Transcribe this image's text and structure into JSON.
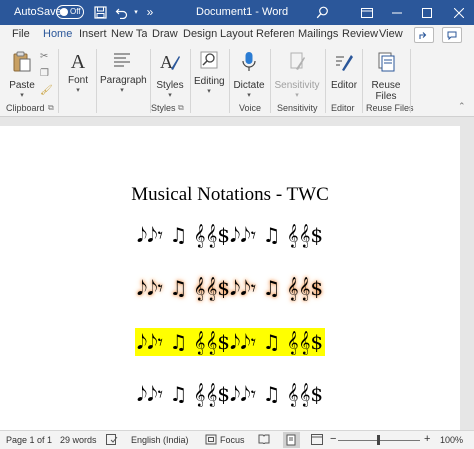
{
  "titlebar": {
    "autosave_label": "AutoSave",
    "autosave_state": "Off",
    "document_title": "Document1  -  Word",
    "more_glyph": "»"
  },
  "tabs": [
    {
      "label": "File"
    },
    {
      "label": "Home"
    },
    {
      "label": "Insert"
    },
    {
      "label": "New Tab"
    },
    {
      "label": "Draw"
    },
    {
      "label": "Design"
    },
    {
      "label": "Layout"
    },
    {
      "label": "References"
    },
    {
      "label": "Mailings"
    },
    {
      "label": "Review"
    },
    {
      "label": "View"
    }
  ],
  "ribbon": {
    "paste": "Paste",
    "font": "Font",
    "paragraph": "Paragraph",
    "styles": "Styles",
    "editing": "Editing",
    "dictate": "Dictate",
    "sensitivity": "Sensitivity",
    "editor": "Editor",
    "reuse_files_line1": "Reuse",
    "reuse_files_line2": "Files",
    "groups": {
      "clipboard": "Clipboard",
      "styles": "Styles",
      "voice": "Voice",
      "sensitivity": "Sensitivity",
      "editor": "Editor",
      "reuse_files": "Reuse Files"
    }
  },
  "document": {
    "title": "Musical Notations - TWC",
    "lines": [
      {
        "style": "plain",
        "text": "𝅘𝅥𝅮𝅘𝅥𝅮𝄾  ♫  𝄞𝄞$𝅘𝅥𝅮𝅘𝅥𝅮𝄾  ♫  𝄞𝄞$"
      },
      {
        "style": "shadow",
        "text": "𝅘𝅥𝅮𝅘𝅥𝅮𝄾  ♫  𝄞𝄞$𝅘𝅥𝅮𝅘𝅥𝅮𝄾  ♫  𝄞𝄞$"
      },
      {
        "style": "highlight",
        "text": "𝅘𝅥𝅮𝅘𝅥𝅮𝄾  ♫  𝄞𝄞$𝅘𝅥𝅮𝅘𝅥𝅮𝄾  ♫  𝄞𝄞$"
      },
      {
        "style": "plain",
        "text": "𝅘𝅥𝅮𝅘𝅥𝅮𝄾  ♫  𝄞𝄞$𝅘𝅥𝅮𝅘𝅥𝅮𝄾  ♫  𝄞𝄞$"
      }
    ],
    "highlight_color": "#ffff00",
    "shadow_color": "#f08a3a"
  },
  "statusbar": {
    "page": "Page 1 of 1",
    "words": "29 words",
    "language": "English (India)",
    "focus": "Focus",
    "zoom": "100%"
  },
  "colors": {
    "accent": "#2b579a"
  }
}
